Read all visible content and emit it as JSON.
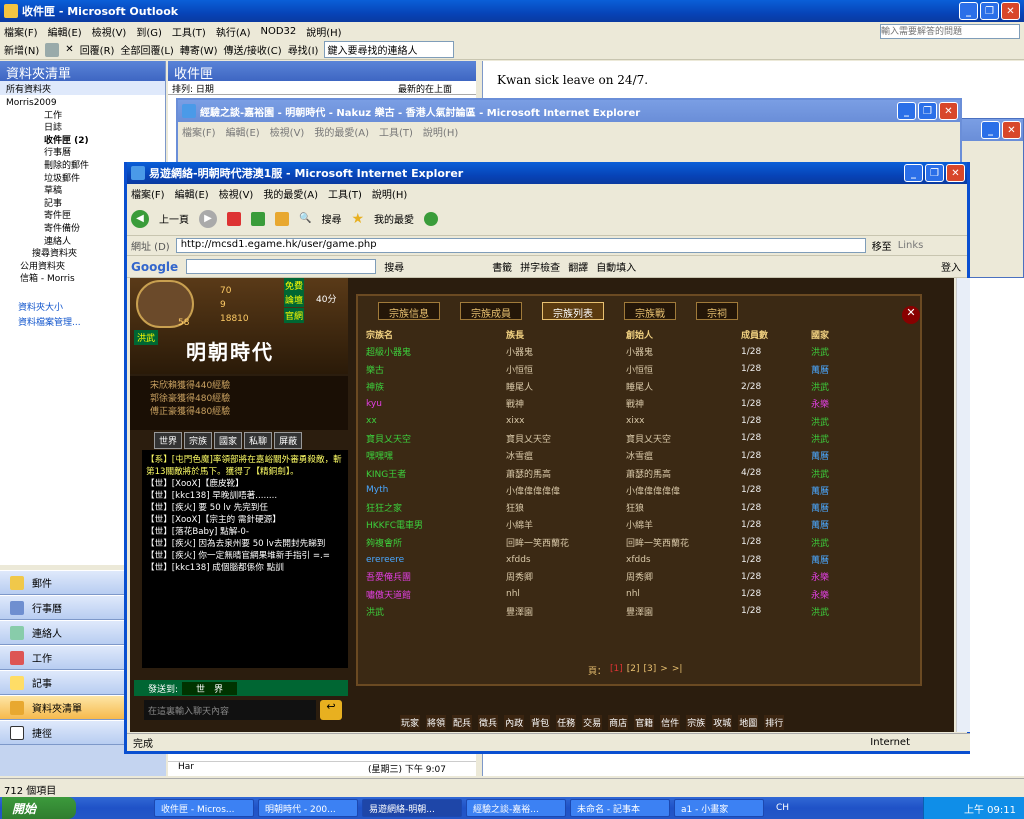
{
  "outlook": {
    "title": "收件匣 - Microsoft Outlook",
    "menu": [
      "檔案(F)",
      "編輯(E)",
      "檢視(V)",
      "到(G)",
      "工具(T)",
      "執行(A)",
      "NOD32",
      "說明(H)"
    ],
    "help_placeholder": "輸入需要解答的問題",
    "toolbar": [
      "新增(N)",
      "回覆(R)",
      "全部回覆(L)",
      "轉寄(W)",
      "傳送/接收(C)",
      "尋找(I)",
      "鍵入要尋找的連絡人"
    ],
    "folder_pane_title": "資料夾清單",
    "all_folders": "所有資料夾",
    "tree": [
      "Morris2009",
      "工作",
      "日誌",
      "收件匣 (2)",
      "行事曆",
      "刪除的郵件",
      "垃圾郵件",
      "草稿",
      "記事",
      "寄件匣",
      "寄件備份",
      "連絡人",
      "搜尋資料夾",
      "公用資料夾",
      "信箱 - Morris"
    ],
    "links": [
      "資料夾大小",
      "資料檔案管理..."
    ],
    "nav": [
      "郵件",
      "行事曆",
      "連絡人",
      "工作",
      "記事",
      "資料夾清單",
      "捷徑"
    ],
    "inbox_title": "收件匣",
    "sort_label": "排列: 日期",
    "sort_order": "最新的在上面",
    "reading_text": "Kwan sick leave on 24/7.",
    "msg_row_from": "Har",
    "msg_row_date": "(星期三) 下午 9:07",
    "status": "712 個項目"
  },
  "ie_back": {
    "title": "經驗之談-嘉裕園 - 明朝時代 - Nakuz 樂古 - 香港人氣討論區 - Microsoft Internet Explorer",
    "menu": [
      "檔案(F)",
      "編輯(E)",
      "檢視(V)",
      "我的最愛(A)",
      "工具(T)",
      "說明(H)"
    ]
  },
  "ie": {
    "title": "易遊網絡-明朝時代港澳1服 - Microsoft Internet Explorer",
    "menu": [
      "檔案(F)",
      "編輯(E)",
      "檢視(V)",
      "我的最愛(A)",
      "工具(T)",
      "說明(H)"
    ],
    "back": "上一頁",
    "search": "搜尋",
    "favorites": "我的最愛",
    "address_label": "網址 (D)",
    "address": "http://mcsd1.egame.hk/user/game.php",
    "go": "移至",
    "links": "Links",
    "google": "Google",
    "g_search": "搜尋",
    "g_bookmarks": "書籤",
    "g_spell": "拼字檢查",
    "g_translate": "翻譯",
    "g_autofill": "自動填入",
    "g_login": "登入",
    "status": "完成",
    "zone": "Internet"
  },
  "game": {
    "stats": [
      "70",
      "9",
      "18810"
    ],
    "level": "58",
    "side_btns": [
      "免費",
      "論壇",
      "官網"
    ],
    "clan_badge": "洪武",
    "game_title": "明朝時代",
    "speed": "40分",
    "feed": [
      "宋欣賴獲得440經驗",
      "郭徐豪獲得480經驗",
      "傅正豪獲得480經驗"
    ],
    "chat_tabs": [
      "世界",
      "宗族",
      "國家",
      "私聊",
      "屏蔽"
    ],
    "chat": [
      "【系】[屯門色魔]率領部將在嘉峪關外審勇殺敵，斬第13關敵將於馬下。獲得了【精銅劍】。",
      "【世】[XooX]【鹿皮靴】",
      "【世】[kkc138] 早晚訓唔著........",
      "【世】[疾火] 要 50 lv 先完到任",
      "【世】[XooX]【宗主的 需針硬源】",
      "【世】[落花Baby] 點解-0-",
      "【世】[疾火] 因為去泉州要 50 lv去開封先睇到",
      "【世】[疾火] 你一定無晴官網果堆新手指引 =.=",
      "【世】[kkc138] 成個腦都係你 點訓"
    ],
    "send_to": "發送到:",
    "channel": "世　界",
    "chat_placeholder": "在這裏輸入聊天內容",
    "tabs": [
      "宗族信息",
      "宗族成員",
      "宗族列表",
      "宗族戰",
      "宗祠"
    ],
    "headers": [
      "宗族名",
      "族長",
      "創始人",
      "成員數",
      "國家"
    ],
    "rows": [
      {
        "name": "超級小器鬼",
        "leader": "小器鬼",
        "founder": "小器鬼",
        "members": "1/28",
        "country": "洪武",
        "c": "#3cd03c",
        "k": "#3cd03c"
      },
      {
        "name": "樂古",
        "leader": "小恒恒",
        "founder": "小恒恒",
        "members": "1/28",
        "country": "萬曆",
        "c": "#3cd03c",
        "k": "#4aa8ff"
      },
      {
        "name": "神族",
        "leader": "睡尾人",
        "founder": "睡尾人",
        "members": "2/28",
        "country": "洪武",
        "c": "#3cd03c",
        "k": "#3cd03c"
      },
      {
        "name": "kyu",
        "leader": "戰神",
        "founder": "戰神",
        "members": "1/28",
        "country": "永樂",
        "c": "#e23fe2",
        "k": "#e23fe2"
      },
      {
        "name": "xx",
        "leader": "xixx",
        "founder": "xixx",
        "members": "1/28",
        "country": "洪武",
        "c": "#3cd03c",
        "k": "#3cd03c"
      },
      {
        "name": "寶貝乂天空",
        "leader": "寶貝乂天空",
        "founder": "寶貝乂天空",
        "members": "1/28",
        "country": "洪武",
        "c": "#3cd03c",
        "k": "#3cd03c"
      },
      {
        "name": "嘿嘿嘿",
        "leader": "冰雪瘟",
        "founder": "冰雪瘟",
        "members": "1/28",
        "country": "萬曆",
        "c": "#3cd03c",
        "k": "#4aa8ff"
      },
      {
        "name": "KING王者",
        "leader": "蕭瑟的馬高",
        "founder": "蕭瑟的馬高",
        "members": "4/28",
        "country": "洪武",
        "c": "#3cd03c",
        "k": "#3cd03c"
      },
      {
        "name": "Myth",
        "leader": "小偉偉偉偉偉",
        "founder": "小偉偉偉偉偉",
        "members": "1/28",
        "country": "萬曆",
        "c": "#4aa8ff",
        "k": "#4aa8ff"
      },
      {
        "name": "狂狂之家",
        "leader": "狂狼",
        "founder": "狂狼",
        "members": "1/28",
        "country": "萬曆",
        "c": "#3cd03c",
        "k": "#4aa8ff"
      },
      {
        "name": "HKKFC電車男",
        "leader": "小綿羊",
        "founder": "小綿羊",
        "members": "1/28",
        "country": "萬曆",
        "c": "#3cd03c",
        "k": "#4aa8ff"
      },
      {
        "name": "夠複會所",
        "leader": "回眸一笑西蘭花",
        "founder": "回眸一笑西蘭花",
        "members": "1/28",
        "country": "洪武",
        "c": "#3cd03c",
        "k": "#3cd03c"
      },
      {
        "name": "erereere",
        "leader": "xfdds",
        "founder": "xfdds",
        "members": "1/28",
        "country": "萬曆",
        "c": "#4aa8ff",
        "k": "#4aa8ff"
      },
      {
        "name": "吾愛俺兵團",
        "leader": "周秀卿",
        "founder": "周秀卿",
        "members": "1/28",
        "country": "永樂",
        "c": "#e23fe2",
        "k": "#e23fe2"
      },
      {
        "name": "嘯傲天道館",
        "leader": "nhl",
        "founder": "nhl",
        "members": "1/28",
        "country": "永樂",
        "c": "#e23fe2",
        "k": "#e23fe2"
      },
      {
        "name": "洪武",
        "leader": "豐澤園",
        "founder": "豐澤園",
        "members": "1/28",
        "country": "洪武",
        "c": "#3cd03c",
        "k": "#3cd03c"
      }
    ],
    "page_label": "頁：",
    "pages": [
      "[1]",
      "[2]",
      "[3]",
      ">",
      ">|"
    ],
    "bottom_menu": [
      "玩家",
      "將領",
      "配兵",
      "徵兵",
      "內政",
      "背包",
      "任務",
      "交易",
      "商店",
      "官籍",
      "信件",
      "宗族",
      "攻城",
      "地圖",
      "排行"
    ]
  },
  "taskbar": {
    "start": "開始",
    "items": [
      "收件匣 - Micros...",
      "明朝時代 - 200...",
      "易遊網絡-明朝...",
      "經驗之談-嘉裕...",
      "未命名 - 記事本",
      "a1 - 小畫家"
    ],
    "lang": "CH",
    "clock": "上午 09:11"
  }
}
